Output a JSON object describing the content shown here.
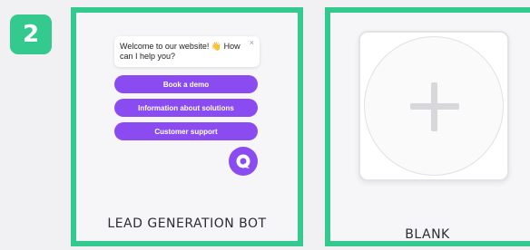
{
  "step": {
    "number": "2"
  },
  "cards": {
    "lead": {
      "title": "LEAD GENERATION BOT",
      "chat": {
        "greeting": "Welcome to our website! 👋 How can I help you?",
        "close_glyph": "×",
        "buttons": [
          "Book a demo",
          "Information about solutions",
          "Customer support"
        ],
        "launcher_icon": "chat-bot-logo-icon"
      }
    },
    "blank": {
      "title": "BLANK",
      "icon": "plus-icon"
    }
  },
  "colors": {
    "accent_green": "#34c98f",
    "bot_purple": "#8a4cf0",
    "background": "#f1f1f3"
  }
}
